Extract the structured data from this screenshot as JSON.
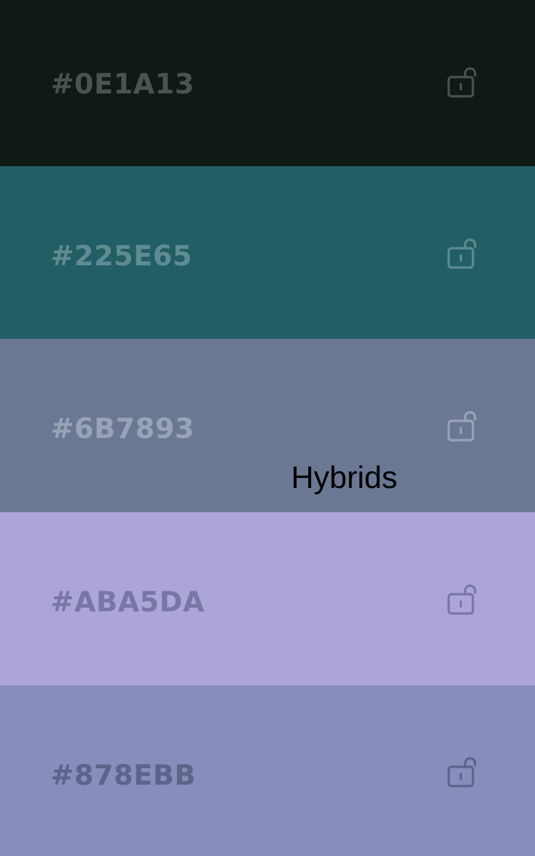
{
  "palette": {
    "swatches": [
      {
        "hex": "#0E1A13",
        "color": "#0E1A13",
        "text_color": "#4A544E",
        "icon": "unlocked-padlock-icon"
      },
      {
        "hex": "#225E65",
        "color": "#225E65",
        "text_color": "#5E8C91",
        "icon": "unlocked-padlock-icon"
      },
      {
        "hex": "#6B7893",
        "color": "#6B7893",
        "text_color": "#9AA3B6",
        "icon": "unlocked-padlock-icon"
      },
      {
        "hex": "#ABA5DA",
        "color": "#ABA5DA",
        "text_color": "#7A76A4",
        "icon": "unlocked-padlock-icon"
      },
      {
        "hex": "#878EBB",
        "color": "#878EBB",
        "text_color": "#5E638A",
        "icon": "unlocked-padlock-icon"
      }
    ]
  },
  "overlay": {
    "label": "Hybrids"
  }
}
